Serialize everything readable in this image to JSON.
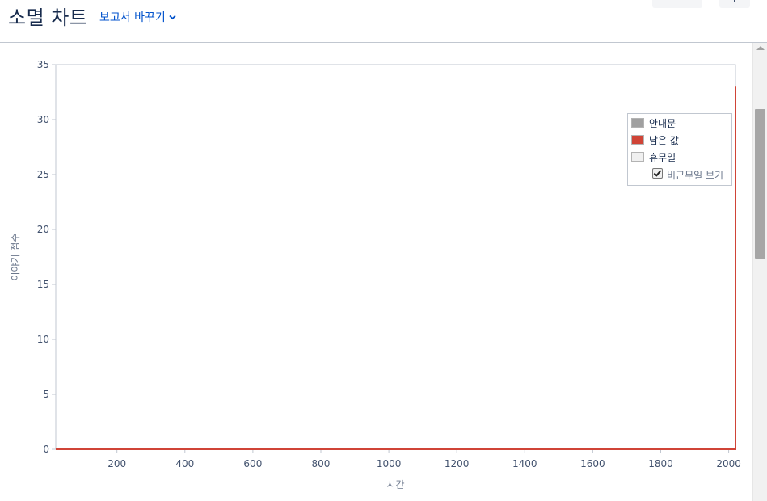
{
  "header": {
    "title": "소멸 차트",
    "report_switch_label": "보고서 바꾸기"
  },
  "chart_data": {
    "type": "line",
    "xlabel": "시간",
    "ylabel": "이야기 점수",
    "xlim": [
      20,
      2020
    ],
    "ylim": [
      0,
      35
    ],
    "x_ticks": [
      200,
      400,
      600,
      800,
      1000,
      1200,
      1400,
      1600,
      1800,
      2000
    ],
    "y_ticks": [
      0,
      5,
      10,
      15,
      20,
      25,
      30,
      35
    ],
    "grid": false,
    "legend_position": "top-right",
    "legend": [
      {
        "label": "안내문",
        "color": "#a0a0a0"
      },
      {
        "label": "남은 값",
        "color": "#d04437"
      },
      {
        "label": "휴무일",
        "color": "#f0f0f0"
      }
    ],
    "show_non_working_days_label": "비근무일 보기",
    "show_non_working_days_checked": true,
    "series": [
      {
        "name": "남은 값",
        "color": "#d04437",
        "points": [
          [
            20,
            0
          ],
          [
            2020,
            0
          ],
          [
            2020,
            33
          ]
        ]
      }
    ]
  }
}
